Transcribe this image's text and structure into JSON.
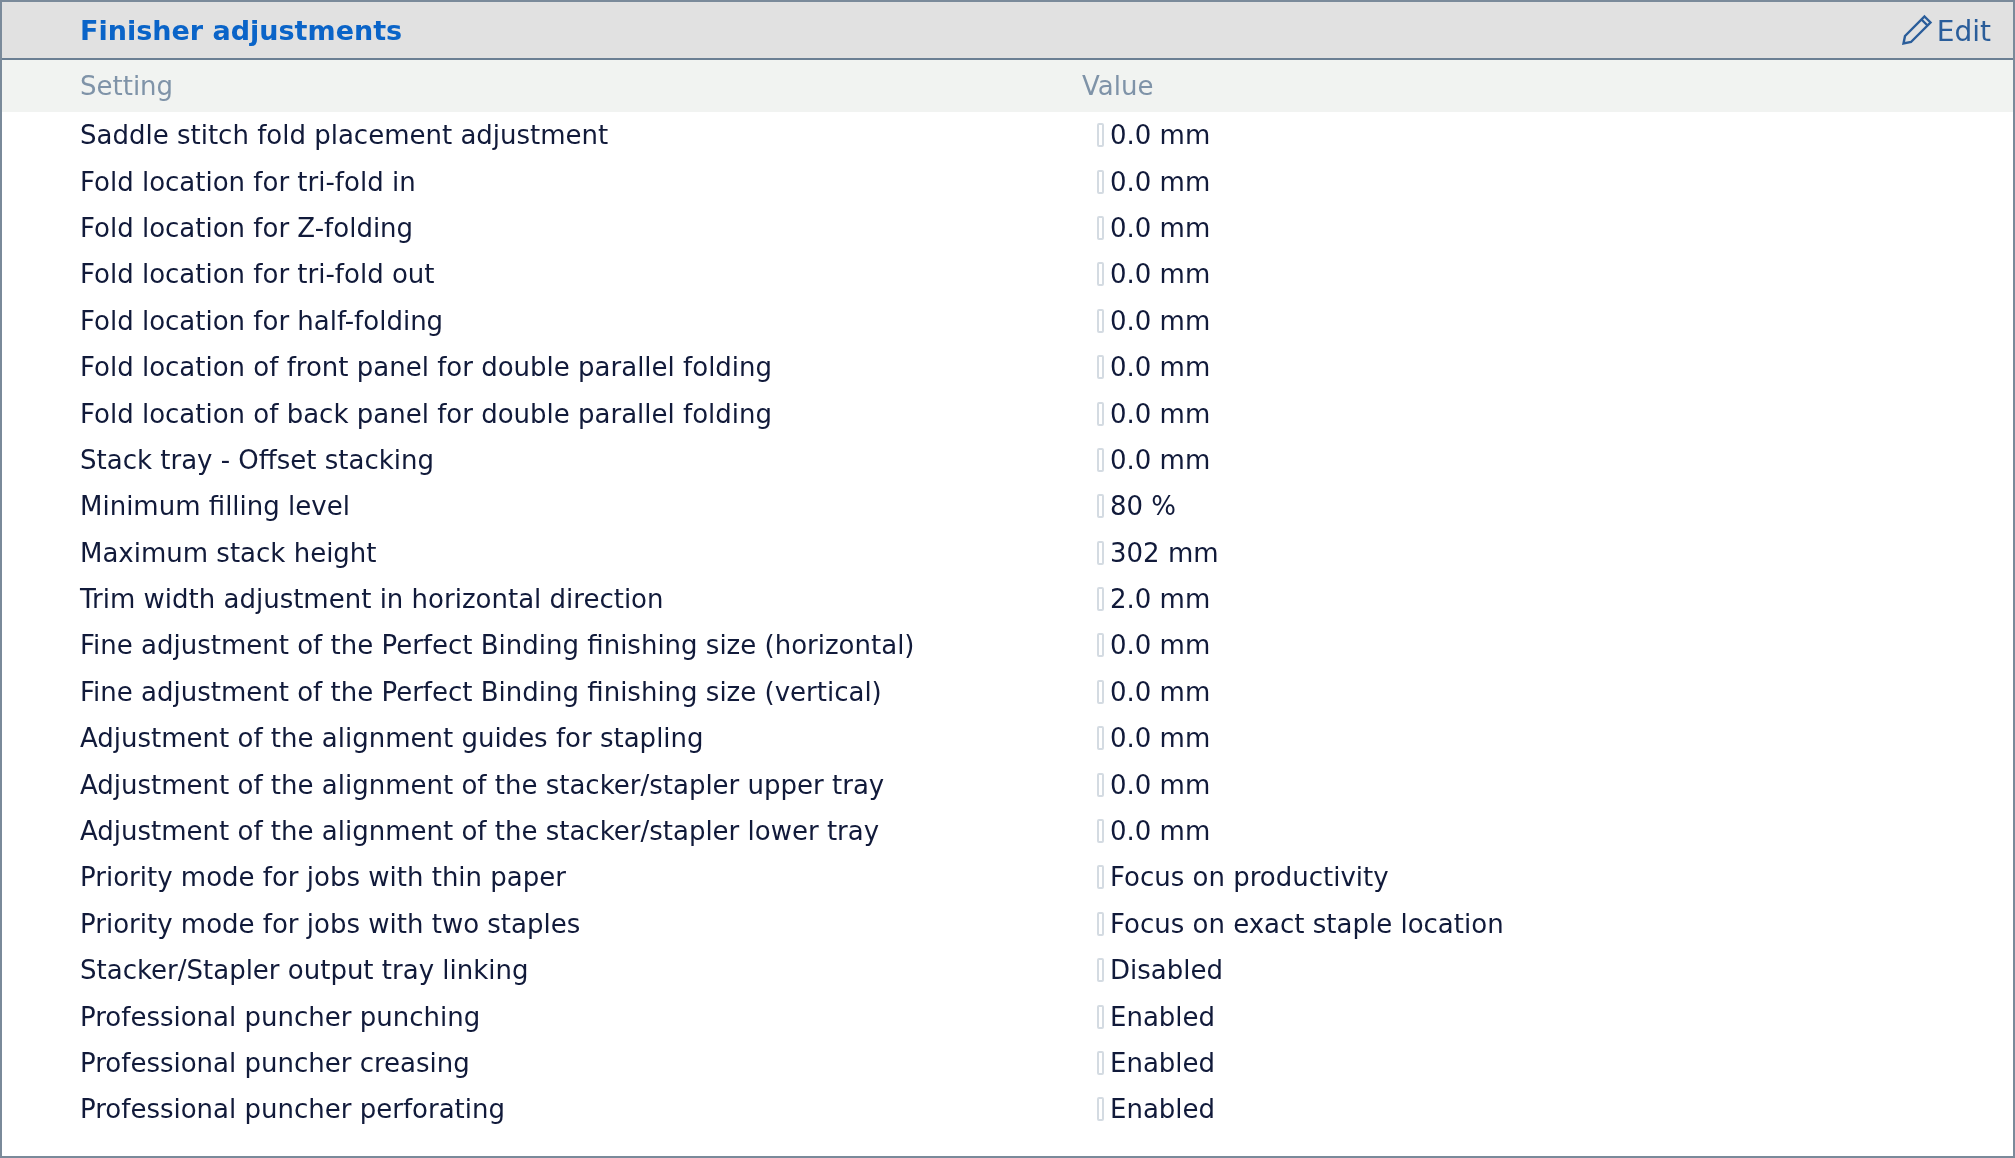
{
  "panel": {
    "title": "Finisher adjustments",
    "edit_label": "Edit"
  },
  "table": {
    "columns": [
      "Setting",
      "Value"
    ],
    "rows": [
      {
        "setting": "Saddle stitch fold placement adjustment",
        "value": "0.0 mm"
      },
      {
        "setting": "Fold location for tri-fold in",
        "value": "0.0 mm"
      },
      {
        "setting": "Fold location for Z-folding",
        "value": "0.0 mm"
      },
      {
        "setting": "Fold location for tri-fold out",
        "value": "0.0 mm"
      },
      {
        "setting": "Fold location for half-folding",
        "value": "0.0 mm"
      },
      {
        "setting": "Fold location of front panel for double parallel folding",
        "value": "0.0 mm"
      },
      {
        "setting": "Fold location of back panel for double parallel folding",
        "value": "0.0 mm"
      },
      {
        "setting": "Stack tray - Offset stacking",
        "value": "0.0 mm"
      },
      {
        "setting": "Minimum filling level",
        "value": "80 %"
      },
      {
        "setting": "Maximum stack height",
        "value": "302 mm"
      },
      {
        "setting": "Trim width adjustment in horizontal direction",
        "value": "2.0 mm"
      },
      {
        "setting": "Fine adjustment of the Perfect Binding finishing size (horizontal)",
        "value": "0.0 mm"
      },
      {
        "setting": "Fine adjustment of the Perfect Binding finishing size (vertical)",
        "value": "0.0 mm"
      },
      {
        "setting": "Adjustment of the alignment guides for stapling",
        "value": "0.0 mm"
      },
      {
        "setting": "Adjustment of the alignment of the stacker/stapler upper tray",
        "value": "0.0 mm"
      },
      {
        "setting": "Adjustment of the alignment of the stacker/stapler lower tray",
        "value": "0.0 mm"
      },
      {
        "setting": "Priority mode for jobs with thin paper",
        "value": "Focus on productivity"
      },
      {
        "setting": "Priority mode for jobs with two staples",
        "value": "Focus on exact staple location"
      },
      {
        "setting": "Stacker/Stapler output tray linking",
        "value": "Disabled"
      },
      {
        "setting": "Professional puncher punching",
        "value": "Enabled"
      },
      {
        "setting": "Professional puncher creasing",
        "value": "Enabled"
      },
      {
        "setting": "Professional puncher perforating",
        "value": "Enabled"
      }
    ]
  }
}
